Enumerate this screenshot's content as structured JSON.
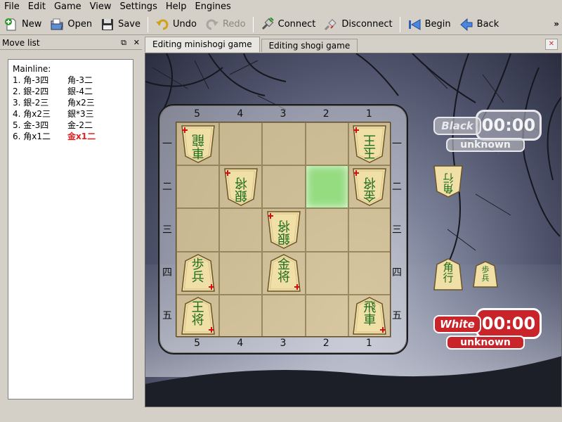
{
  "menu": [
    "File",
    "Edit",
    "Game",
    "View",
    "Settings",
    "Help",
    "Engines"
  ],
  "toolbar": {
    "new": "New",
    "open": "Open",
    "save": "Save",
    "undo": "Undo",
    "redo": "Redo",
    "connect": "Connect",
    "disconnect": "Disconnect",
    "begin": "Begin",
    "back": "Back",
    "more": "»"
  },
  "movelist": {
    "panel_title": "Move list",
    "float_btn": "⧉",
    "close_btn": "✕",
    "heading": "Mainline:",
    "rows": [
      {
        "num": "1.",
        "black": "角-3四",
        "white": "角-3二"
      },
      {
        "num": "2.",
        "black": "銀-2四",
        "white": "銀-4二"
      },
      {
        "num": "3.",
        "black": "銀-2三",
        "white": "角x2三"
      },
      {
        "num": "4.",
        "black": "角x2三",
        "white": "銀*3三"
      },
      {
        "num": "5.",
        "black": "金-3四",
        "white": "金-2二"
      },
      {
        "num": "6.",
        "black": "角x1二",
        "white": "金x1二"
      }
    ]
  },
  "tabs": [
    {
      "label": "Editing minishogi game",
      "active": true
    },
    {
      "label": "Editing shogi game",
      "active": false
    }
  ],
  "board": {
    "files": [
      "5",
      "4",
      "3",
      "2",
      "1"
    ],
    "ranks": [
      "一",
      "二",
      "三",
      "四",
      "五"
    ],
    "highlight": {
      "file": "2",
      "rank": "二"
    },
    "pieces": [
      {
        "file": "5",
        "rank": "一",
        "top": "車",
        "bottom": "龍",
        "side": "gote",
        "promoted": true
      },
      {
        "file": "1",
        "rank": "一",
        "top": "玉",
        "bottom": "王",
        "side": "gote",
        "promoted": false
      },
      {
        "file": "4",
        "rank": "二",
        "top": "銀",
        "bottom": "将",
        "side": "gote",
        "promoted": false
      },
      {
        "file": "1",
        "rank": "二",
        "top": "金",
        "bottom": "将",
        "side": "gote",
        "promoted": false
      },
      {
        "file": "3",
        "rank": "三",
        "top": "銀",
        "bottom": "将",
        "side": "gote",
        "promoted": false
      },
      {
        "file": "5",
        "rank": "四",
        "top": "歩",
        "bottom": "兵",
        "side": "sente",
        "promoted": false
      },
      {
        "file": "3",
        "rank": "四",
        "top": "金",
        "bottom": "将",
        "side": "sente",
        "promoted": false
      },
      {
        "file": "5",
        "rank": "五",
        "top": "王",
        "bottom": "将",
        "side": "sente",
        "promoted": false
      },
      {
        "file": "1",
        "rank": "五",
        "top": "飛",
        "bottom": "車",
        "side": "sente",
        "promoted": false
      }
    ]
  },
  "hands": {
    "black": [
      {
        "top": "角",
        "bottom": "行"
      }
    ],
    "white": [
      {
        "top": "角",
        "bottom": "行"
      },
      {
        "top": "歩",
        "bottom": "兵"
      }
    ]
  },
  "clocks": {
    "black": {
      "name": "Black",
      "time": "00:00",
      "status": "unknown",
      "color": "#e8e8ec"
    },
    "white": {
      "name": "White",
      "time": "00:00",
      "status": "unknown",
      "color": "#c8242a"
    }
  }
}
